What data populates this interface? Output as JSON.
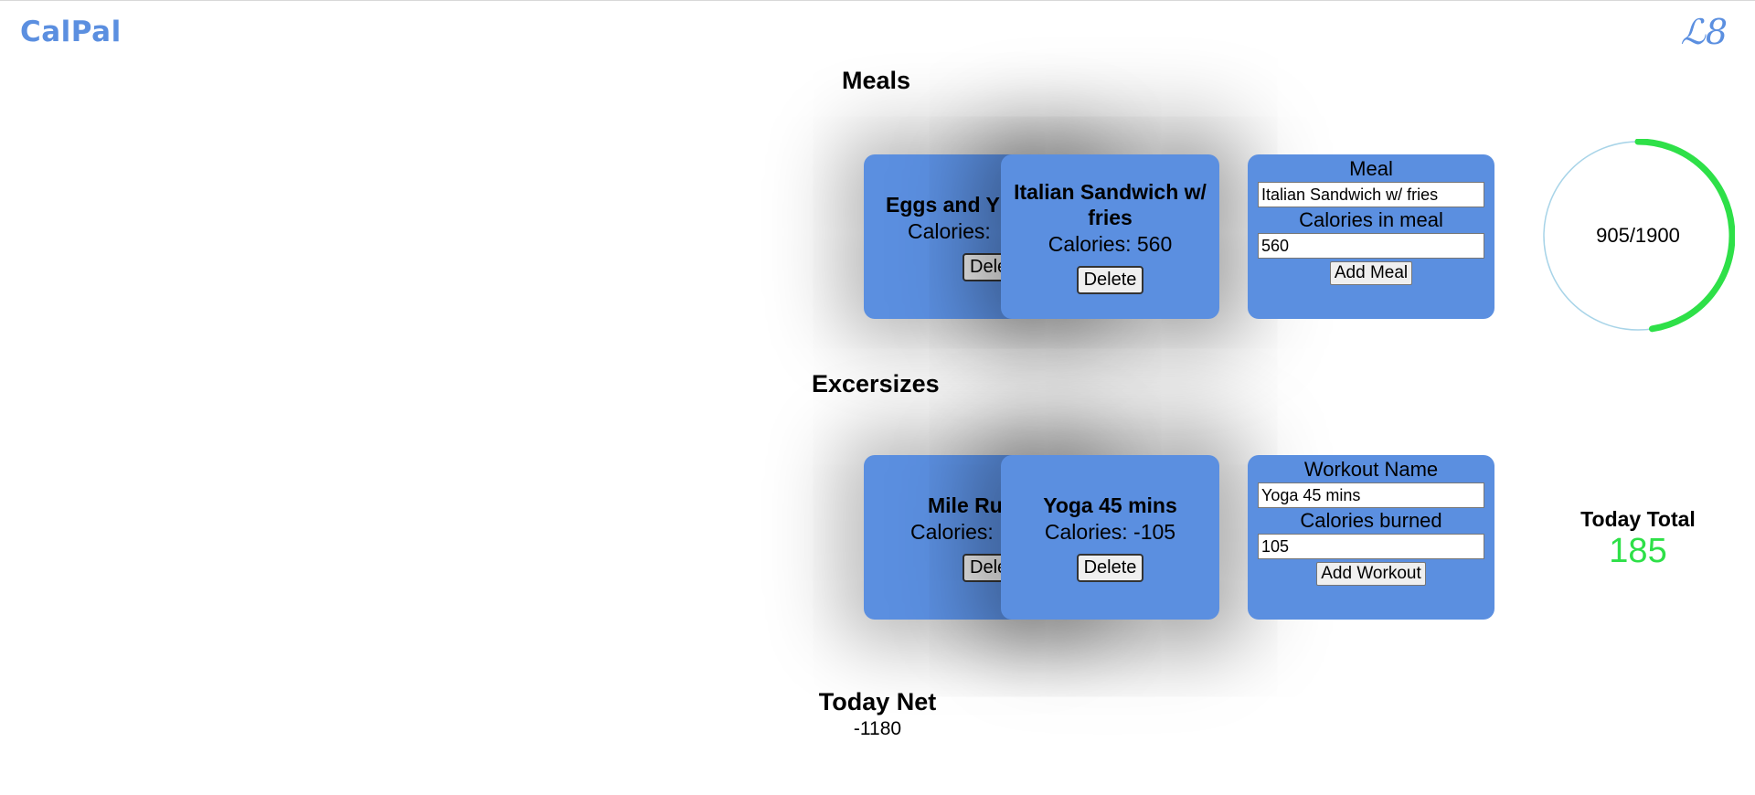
{
  "app": {
    "logo": "CalPal",
    "monogram": "ℒ8"
  },
  "meals": {
    "title": "Meals",
    "items": [
      {
        "name": "Eggs and Y",
        "calories_label": "Calories:",
        "delete_label": "Delete"
      },
      {
        "name": "Italian Sandwich w/ fries",
        "calories_label": "Calories: 560",
        "delete_label": "Delete"
      }
    ],
    "form": {
      "name_label": "Meal",
      "name_value": "Italian Sandwich w/ fries",
      "calories_label": "Calories in meal",
      "calories_value": "560",
      "submit_label": "Add Meal"
    }
  },
  "exercises": {
    "title": "Excersizes",
    "items": [
      {
        "name": "Mile Ru",
        "calories_label": "Calories:",
        "delete_label": "Delete"
      },
      {
        "name": "Yoga 45 mins",
        "calories_label": "Calories: -105",
        "delete_label": "Delete"
      }
    ],
    "form": {
      "name_label": "Workout Name",
      "name_value": "Yoga 45 mins",
      "calories_label": "Calories burned",
      "calories_value": "105",
      "submit_label": "Add Workout"
    }
  },
  "progress": {
    "text": "905/1900",
    "consumed": 905,
    "goal": 1900,
    "fraction": 0.476,
    "ring_color": "#2ee048",
    "track_color": "#a8d4e8"
  },
  "today_total": {
    "label": "Today Total",
    "value": "185",
    "color": "#2ee048"
  },
  "today_net": {
    "label": "Today Net",
    "value": "-1180"
  },
  "colors": {
    "card": "#5b8fe0",
    "accent": "#5b8fe0"
  }
}
